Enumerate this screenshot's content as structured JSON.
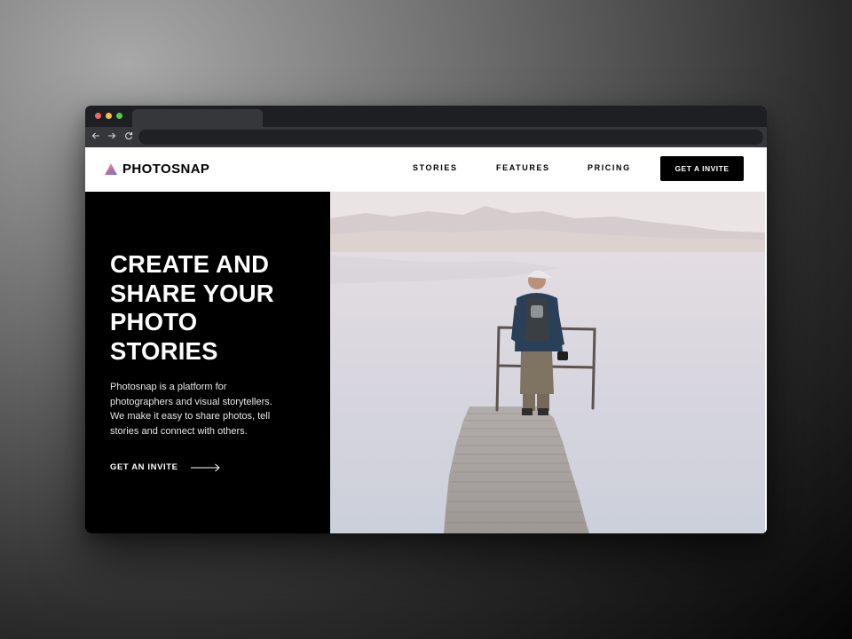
{
  "brand": {
    "name": "PHOTOSNAP"
  },
  "nav": {
    "links": [
      "STORIES",
      "FEATURES",
      "PRICING"
    ],
    "cta_label": "GET A INVITE"
  },
  "hero": {
    "title_lines": [
      "CREATE AND",
      "SHARE YOUR",
      "PHOTO",
      "STORIES"
    ],
    "description_lines": [
      "Photosnap is a platform for",
      "photographers and visual storytellers.",
      "We make it easy to share photos, tell",
      "stories and connect with others."
    ],
    "cta_label": "GET AN INVITE",
    "image": "man standing on wooden pier by a misty lake"
  },
  "browser": {
    "controls": [
      "back-icon",
      "forward-icon",
      "reload-icon"
    ]
  },
  "colors": {
    "hero_panel": "#000000",
    "cta_bg": "#000000",
    "logo_gradient": [
      "#ffc593",
      "#bc7198",
      "#5a77ff"
    ]
  }
}
